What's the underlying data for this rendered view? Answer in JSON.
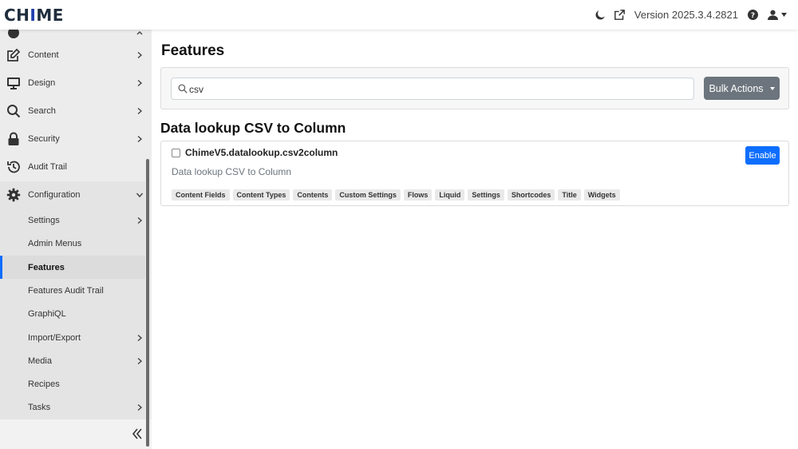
{
  "header": {
    "logo": {
      "part1": "CH",
      "part2": "I",
      "part3": "ME"
    },
    "version": "Version 2025.3.4.2821",
    "icons": [
      "moon-icon",
      "external-link-icon",
      "help-icon",
      "user-icon"
    ]
  },
  "sidebar": {
    "items": [
      {
        "label": "Content",
        "icon": "edit-icon",
        "has_chevron": true
      },
      {
        "label": "Design",
        "icon": "monitor-icon",
        "has_chevron": true
      },
      {
        "label": "Search",
        "icon": "search-icon",
        "has_chevron": true
      },
      {
        "label": "Security",
        "icon": "lock-icon",
        "has_chevron": true
      },
      {
        "label": "Audit Trail",
        "icon": "history-icon",
        "has_chevron": false
      },
      {
        "label": "Configuration",
        "icon": "gear-icon",
        "has_chevron": true,
        "expanded": true
      }
    ],
    "sub_items": [
      {
        "label": "Settings",
        "has_chevron": true
      },
      {
        "label": "Admin Menus",
        "has_chevron": false
      },
      {
        "label": "Features",
        "has_chevron": false,
        "active": true
      },
      {
        "label": "Features Audit Trail",
        "has_chevron": false
      },
      {
        "label": "GraphiQL",
        "has_chevron": false
      },
      {
        "label": "Import/Export",
        "has_chevron": true
      },
      {
        "label": "Media",
        "has_chevron": true
      },
      {
        "label": "Recipes",
        "has_chevron": false
      },
      {
        "label": "Tasks",
        "has_chevron": true
      }
    ]
  },
  "main": {
    "title": "Features",
    "search": {
      "value": "csv",
      "placeholder": ""
    },
    "bulk_actions_label": "Bulk Actions",
    "section_title": "Data lookup CSV to Column",
    "feature": {
      "id": "ChimeV5.datalookup.csv2column",
      "description": "Data lookup CSV to Column",
      "enable_label": "Enable",
      "tags": [
        "Content Fields",
        "Content Types",
        "Contents",
        "Custom Settings",
        "Flows",
        "Liquid",
        "Settings",
        "Shortcodes",
        "Title",
        "Widgets"
      ]
    }
  },
  "colors": {
    "accent": "#0d6efd",
    "logo_accent": "#1f3fae",
    "secondary_button": "#6c757d"
  }
}
